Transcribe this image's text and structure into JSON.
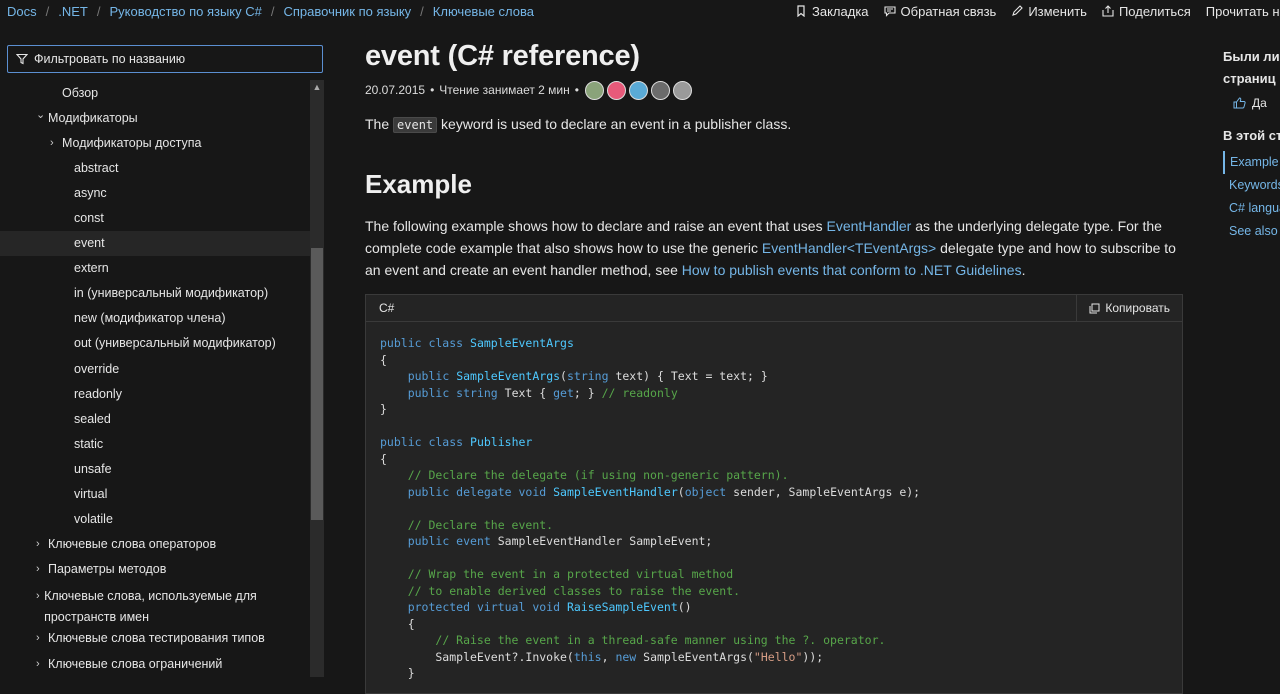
{
  "breadcrumbs": [
    "Docs",
    ".NET",
    "Руководство по языку C#",
    "Справочник по языку",
    "Ключевые слова"
  ],
  "actions": {
    "bookmark": "Закладка",
    "feedback": "Обратная связь",
    "edit": "Изменить",
    "share": "Поделиться",
    "read_in": "Прочитать на ан"
  },
  "filter": {
    "placeholder": "Фильтровать по названию"
  },
  "toc": [
    {
      "label": "Обзор",
      "level": 1,
      "chevron": ""
    },
    {
      "label": "Модификаторы",
      "level": 0,
      "chevron": "down"
    },
    {
      "label": "Модификаторы доступа",
      "level": 1,
      "chevron": "right"
    },
    {
      "label": "abstract",
      "level": 2,
      "chevron": ""
    },
    {
      "label": "async",
      "level": 2,
      "chevron": ""
    },
    {
      "label": "const",
      "level": 2,
      "chevron": ""
    },
    {
      "label": "event",
      "level": 2,
      "chevron": "",
      "active": true
    },
    {
      "label": "extern",
      "level": 2,
      "chevron": ""
    },
    {
      "label": "in (универсальный модификатор)",
      "level": 2,
      "chevron": ""
    },
    {
      "label": "new (модификатор члена)",
      "level": 2,
      "chevron": ""
    },
    {
      "label": "out (универсальный модификатор)",
      "level": 2,
      "chevron": ""
    },
    {
      "label": "override",
      "level": 2,
      "chevron": ""
    },
    {
      "label": "readonly",
      "level": 2,
      "chevron": ""
    },
    {
      "label": "sealed",
      "level": 2,
      "chevron": ""
    },
    {
      "label": "static",
      "level": 2,
      "chevron": ""
    },
    {
      "label": "unsafe",
      "level": 2,
      "chevron": ""
    },
    {
      "label": "virtual",
      "level": 2,
      "chevron": ""
    },
    {
      "label": "volatile",
      "level": 2,
      "chevron": ""
    },
    {
      "label": "Ключевые слова операторов",
      "level": 0,
      "chevron": "right"
    },
    {
      "label": "Параметры методов",
      "level": 0,
      "chevron": "right"
    },
    {
      "label": "Ключевые слова, используемые для пространств имен",
      "level": 0,
      "chevron": "right",
      "two_line": true
    },
    {
      "label": "Ключевые слова тестирования типов",
      "level": 0,
      "chevron": "right"
    },
    {
      "label": "Ключевые слова ограничений",
      "level": 0,
      "chevron": "right"
    }
  ],
  "article": {
    "title": "event (C# reference)",
    "date": "20.07.2015",
    "read_time": "Чтение занимает 2 мин",
    "bullet": "•",
    "contributor_colors": [
      "#8aa37a",
      "#e85a7a",
      "#5aaad6",
      "#6b6b6b",
      "#9a9a9a"
    ],
    "lead_pre": "The ",
    "lead_code": "event",
    "lead_post": " keyword is used to declare an event in a publisher class.",
    "example_heading": "Example",
    "para": {
      "p1": "The following example shows how to declare and raise an event that uses ",
      "link1": "EventHandler",
      "p2": " as the underlying delegate type. For the complete code example that also shows how to use the generic ",
      "link2": "EventHandler<TEventArgs>",
      "p3": " delegate type and how to subscribe to an event and create an event handler method, see ",
      "link3": "How to publish events that conform to .NET Guidelines",
      "p4": "."
    },
    "code": {
      "language": "C#",
      "copy_label": "Копировать"
    }
  },
  "rail": {
    "question": "Были ли страниц",
    "q_line1": "Были ли",
    "q_line2": "страниц",
    "yes": "Да",
    "on_this_page": "В этой ст",
    "links": [
      "Example",
      "Keywords",
      "C# langua",
      "See also"
    ]
  }
}
